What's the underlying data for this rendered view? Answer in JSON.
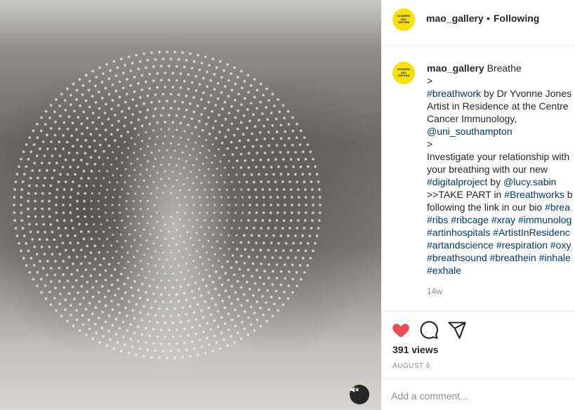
{
  "post": {
    "username": "mao_gallery",
    "follow_separator": "•",
    "follow_status": "Following",
    "avatar_text": "MODERN ART OXFORD",
    "mute_icon": "speaker-muted-icon"
  },
  "caption": {
    "username": "mao_gallery",
    "lines": [
      [
        {
          "t": "Breathe",
          "k": "text"
        }
      ],
      [
        {
          "t": ">",
          "k": "text"
        }
      ],
      [
        {
          "t": "#breathwork",
          "k": "tag"
        },
        {
          "t": " by Dr Yvonne Jones",
          "k": "text"
        }
      ],
      [
        {
          "t": "Artist in Residence at the Centre",
          "k": "text"
        }
      ],
      [
        {
          "t": "Cancer Immunology,",
          "k": "text"
        }
      ],
      [
        {
          "t": "@uni_southampton",
          "k": "tag"
        }
      ],
      [
        {
          "t": ">",
          "k": "text"
        }
      ],
      [
        {
          "t": "Investigate your relationship with",
          "k": "text"
        }
      ],
      [
        {
          "t": "your breathing with our new",
          "k": "text"
        }
      ],
      [
        {
          "t": "#digitalproject",
          "k": "tag"
        },
        {
          "t": " by ",
          "k": "text"
        },
        {
          "t": "@lucy.sabin",
          "k": "tag"
        }
      ],
      [
        {
          "t": ">>TAKE PART in ",
          "k": "text"
        },
        {
          "t": "#Breathworks",
          "k": "tag"
        },
        {
          "t": " b",
          "k": "text"
        }
      ],
      [
        {
          "t": "following the link in our bio ",
          "k": "text"
        },
        {
          "t": "#brea",
          "k": "tag"
        }
      ],
      [
        {
          "t": "#ribs",
          "k": "tag"
        },
        {
          "t": " ",
          "k": "text"
        },
        {
          "t": "#ribcage",
          "k": "tag"
        },
        {
          "t": " ",
          "k": "text"
        },
        {
          "t": "#xray",
          "k": "tag"
        },
        {
          "t": " ",
          "k": "text"
        },
        {
          "t": "#immunolog",
          "k": "tag"
        }
      ],
      [
        {
          "t": "#artinhospitals",
          "k": "tag"
        },
        {
          "t": " ",
          "k": "text"
        },
        {
          "t": "#ArtistInResidenc",
          "k": "tag"
        }
      ],
      [
        {
          "t": "#artandscience",
          "k": "tag"
        },
        {
          "t": " ",
          "k": "text"
        },
        {
          "t": "#respiration",
          "k": "tag"
        },
        {
          "t": " ",
          "k": "text"
        },
        {
          "t": "#oxy",
          "k": "tag"
        }
      ],
      [
        {
          "t": "#breathsound",
          "k": "tag"
        },
        {
          "t": " ",
          "k": "text"
        },
        {
          "t": "#breathein",
          "k": "tag"
        },
        {
          "t": " ",
          "k": "text"
        },
        {
          "t": "#inhale",
          "k": "tag"
        }
      ],
      [
        {
          "t": "#exhale",
          "k": "tag"
        }
      ]
    ],
    "time_ago": "14w"
  },
  "actions": {
    "like_icon": "heart-filled-icon",
    "comment_icon": "comment-icon",
    "share_icon": "paper-plane-icon",
    "like_color": "#ed4956",
    "views": "391 views",
    "date": "AUGUST 6"
  },
  "comment": {
    "placeholder": "Add a comment..."
  }
}
